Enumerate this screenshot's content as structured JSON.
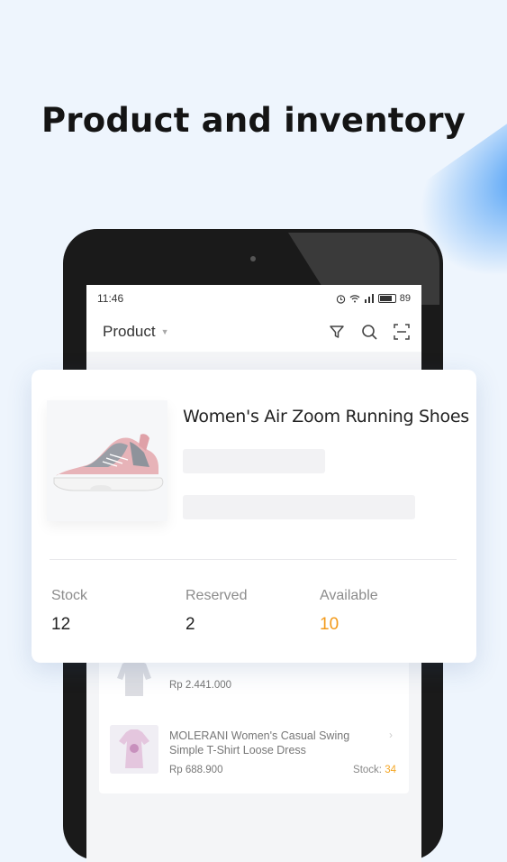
{
  "headline": "Product and inventory",
  "status_bar": {
    "time": "11:46",
    "battery": "89"
  },
  "app_bar": {
    "title": "Product",
    "icons": [
      "filter-icon",
      "search-icon",
      "scan-icon"
    ]
  },
  "featured_product": {
    "name": "Women's Air Zoom Running Shoes",
    "stats": [
      {
        "label": "Stock",
        "value": "12"
      },
      {
        "label": "Reserved",
        "value": "2"
      },
      {
        "label": "Available",
        "value": "10"
      }
    ],
    "available_color": "#f39a1a"
  },
  "product_list": [
    {
      "name": "",
      "price": "Rp 2.441.000",
      "stock_label": "",
      "stock_value": ""
    },
    {
      "name": "MOLERANI Women's Casual Swing Simple T-Shirt Loose Dress",
      "price": "Rp 688.900",
      "stock_label": "Stock:",
      "stock_value": "34"
    }
  ]
}
